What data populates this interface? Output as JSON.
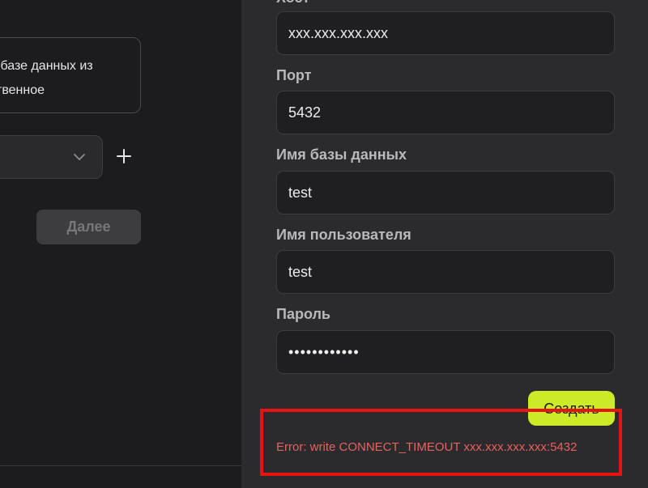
{
  "background_panel": {
    "info_card": {
      "line1": "к базе данных из",
      "line2": "ственное"
    },
    "database_select": {
      "value": "",
      "icon": "chevron-down-icon"
    },
    "add_button": {
      "icon": "plus-icon",
      "symbol": "+"
    },
    "next_button": {
      "label": "Далее",
      "enabled": false
    }
  },
  "form": {
    "fields": [
      {
        "key": "host",
        "label": "Хост",
        "value": "xxx.xxx.xxx.xxx"
      },
      {
        "key": "port",
        "label": "Порт",
        "value": "5432"
      },
      {
        "key": "database",
        "label": "Имя базы данных",
        "value": "test"
      },
      {
        "key": "user",
        "label": "Имя пользователя",
        "value": "test"
      },
      {
        "key": "password",
        "label": "Пароль",
        "value": "••••••••••••"
      }
    ],
    "submit_button": {
      "label": "Создать"
    },
    "error_message": "Error: write CONNECT_TIMEOUT xxx.xxx.xxx.xxx:5432"
  },
  "colors": {
    "accent": "#ccea26",
    "error_text": "#e8615e",
    "highlight_border": "#e8120f",
    "panel_bg": "#2b2b2d",
    "page_bg": "#1c1c1e"
  }
}
